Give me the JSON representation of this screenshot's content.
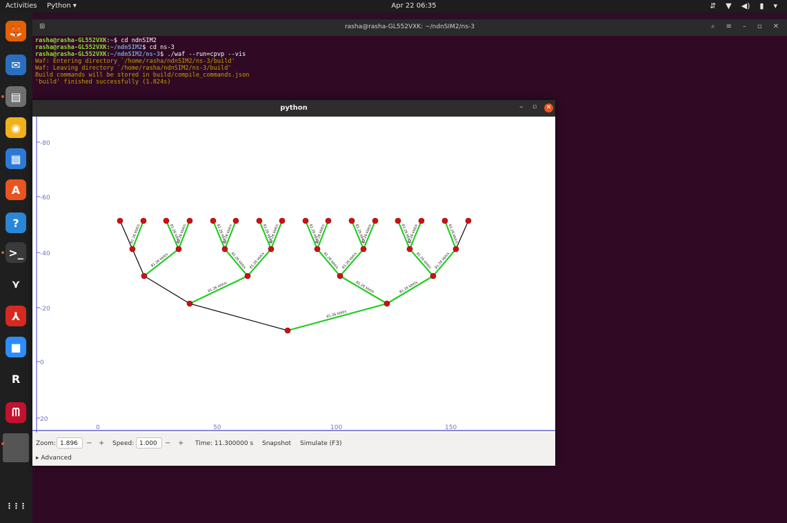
{
  "topbar": {
    "activities": "Activities",
    "app_menu": "Python ▾",
    "clock": "Apr 22 06:35",
    "tray": [
      "⇵",
      "▼",
      "◀)",
      "▮",
      "▾"
    ]
  },
  "dock": {
    "items": [
      {
        "name": "firefox-icon",
        "color": "#e66000",
        "glyph": "🦊",
        "running": false
      },
      {
        "name": "thunderbird-icon",
        "color": "#2a6fbf",
        "glyph": "✉",
        "running": false
      },
      {
        "name": "files-icon",
        "color": "#6f6f6f",
        "glyph": "▤",
        "running": true
      },
      {
        "name": "rhythmbox-icon",
        "color": "#f0b21c",
        "glyph": "◉",
        "running": false
      },
      {
        "name": "writer-icon",
        "color": "#2d7ad6",
        "glyph": "▦",
        "running": false
      },
      {
        "name": "software-icon",
        "color": "#e95420",
        "glyph": "A",
        "running": false
      },
      {
        "name": "help-icon",
        "color": "#2a86d6",
        "glyph": "?",
        "running": false
      },
      {
        "name": "terminal-icon",
        "color": "#3a3a3a",
        "glyph": ">_",
        "running": true
      },
      {
        "name": "wireshark-icon",
        "color": "#1f1f1f",
        "glyph": "⋎",
        "running": false
      },
      {
        "name": "pdf-reader-icon",
        "color": "#d42a20",
        "glyph": "⅄",
        "running": false
      },
      {
        "name": "zoom-icon",
        "color": "#2d8cff",
        "glyph": "■",
        "running": false
      },
      {
        "name": "r-icon",
        "color": "#1f1f1f",
        "glyph": "R",
        "running": false
      },
      {
        "name": "mendeley-icon",
        "color": "#c4122e",
        "glyph": "ᗰ",
        "running": false
      },
      {
        "name": "python-app-icon",
        "color": "#555555",
        "glyph": "",
        "running": true
      }
    ],
    "show_apps": "⋮⋮⋮"
  },
  "terminal": {
    "title": "rasha@rasha-GL552VXK: ~/ndnSIM2/ns-3",
    "lines": [
      {
        "user": "rasha@rasha-GL552VXK:",
        "path": "~",
        "cmd": "$ cd ndnSIM2"
      },
      {
        "user": "rasha@rasha-GL552VXK:",
        "path": "~/ndnSIM2",
        "cmd": "$ cd ns-3"
      },
      {
        "user": "rasha@rasha-GL552VXK:",
        "path": "~/ndnSIM2/ns-3",
        "cmd": "$ ./waf --run=cpvp --vis"
      },
      {
        "out": "Waf: Entering directory `/home/rasha/ndnSIM2/ns-3/build'"
      },
      {
        "out": "Waf: Leaving directory `/home/rasha/ndnSIM2/ns-3/build'"
      },
      {
        "out": "Build commands will be stored in build/compile_commands.json"
      },
      {
        "out": "'build' finished successfully (1.824s)"
      }
    ]
  },
  "python_window": {
    "title": "python",
    "min": "–",
    "max": "▫",
    "close": "✕",
    "axis_left": [
      "-80",
      "-60",
      "-40",
      "-20",
      "0",
      "20"
    ],
    "axis_bottom": [
      "0",
      "50",
      "100",
      "150"
    ],
    "link_label": "81.26 kbit/s",
    "nodes": [
      {
        "id": "r"
      },
      {
        "id": "a1"
      },
      {
        "id": "a2"
      },
      {
        "id": "b1"
      },
      {
        "id": "b2"
      },
      {
        "id": "b3"
      },
      {
        "id": "b4"
      },
      {
        "id": "c1"
      },
      {
        "id": "c2"
      },
      {
        "id": "c3"
      },
      {
        "id": "c4"
      },
      {
        "id": "c5"
      },
      {
        "id": "c6"
      },
      {
        "id": "c7"
      },
      {
        "id": "c8"
      },
      {
        "id": "l1"
      },
      {
        "id": "l2"
      },
      {
        "id": "l3"
      },
      {
        "id": "l4"
      },
      {
        "id": "l5"
      },
      {
        "id": "l6"
      },
      {
        "id": "l7"
      },
      {
        "id": "l8"
      },
      {
        "id": "l9"
      },
      {
        "id": "l10"
      },
      {
        "id": "l11"
      },
      {
        "id": "l12"
      },
      {
        "id": "l13"
      },
      {
        "id": "l14"
      },
      {
        "id": "l15"
      },
      {
        "id": "l16"
      }
    ],
    "links": [
      {
        "from": "r",
        "to": "a1",
        "active": false
      },
      {
        "from": "r",
        "to": "a2",
        "active": true
      },
      {
        "from": "a1",
        "to": "b1",
        "active": false
      },
      {
        "from": "a1",
        "to": "b2",
        "active": true
      },
      {
        "from": "a2",
        "to": "b3",
        "active": true
      },
      {
        "from": "a2",
        "to": "b4",
        "active": true
      },
      {
        "from": "b1",
        "to": "c1",
        "active": false
      },
      {
        "from": "b1",
        "to": "c2",
        "active": true
      },
      {
        "from": "b2",
        "to": "c3",
        "active": true
      },
      {
        "from": "b2",
        "to": "c4",
        "active": true
      },
      {
        "from": "b3",
        "to": "c5",
        "active": true
      },
      {
        "from": "b3",
        "to": "c6",
        "active": true
      },
      {
        "from": "b4",
        "to": "c7",
        "active": true
      },
      {
        "from": "b4",
        "to": "c8",
        "active": true
      },
      {
        "from": "c1",
        "to": "l1",
        "active": false
      },
      {
        "from": "c1",
        "to": "l2",
        "active": true
      },
      {
        "from": "c2",
        "to": "l3",
        "active": true
      },
      {
        "from": "c2",
        "to": "l4",
        "active": true
      },
      {
        "from": "c3",
        "to": "l5",
        "active": true
      },
      {
        "from": "c3",
        "to": "l6",
        "active": true
      },
      {
        "from": "c4",
        "to": "l7",
        "active": true
      },
      {
        "from": "c4",
        "to": "l8",
        "active": true
      },
      {
        "from": "c5",
        "to": "l9",
        "active": true
      },
      {
        "from": "c5",
        "to": "l10",
        "active": true
      },
      {
        "from": "c6",
        "to": "l11",
        "active": true
      },
      {
        "from": "c6",
        "to": "l12",
        "active": true
      },
      {
        "from": "c7",
        "to": "l13",
        "active": true
      },
      {
        "from": "c7",
        "to": "l14",
        "active": true
      },
      {
        "from": "c8",
        "to": "l15",
        "active": true
      },
      {
        "from": "c8",
        "to": "l16",
        "active": false
      }
    ],
    "colors": {
      "node": "#d01010",
      "active_link": "#22cc22",
      "idle_link": "#111111",
      "axis": "#6060d0"
    },
    "controls": {
      "zoom_label": "Zoom:",
      "zoom_value": "1.896",
      "minus": "−",
      "plus": "+",
      "speed_label": "Speed:",
      "speed_value": "1.000",
      "time": "Time: 11.300000 s",
      "snapshot": "Snapshot",
      "simulate": "Simulate (F3)",
      "advanced": "▸ Advanced"
    }
  }
}
